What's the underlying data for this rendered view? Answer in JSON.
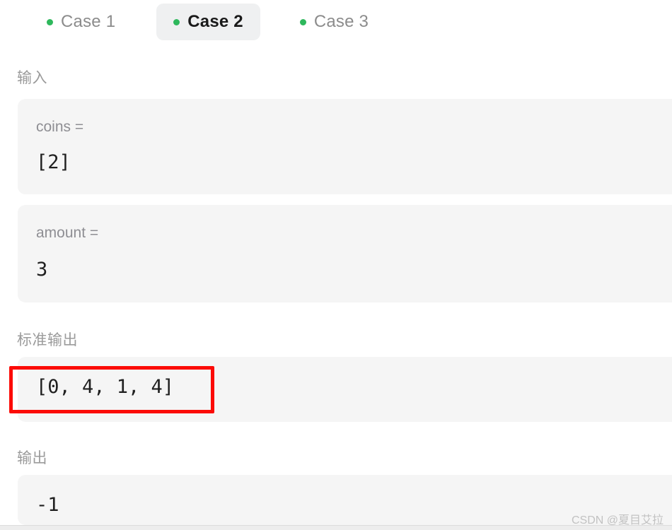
{
  "tabs": [
    {
      "label": "Case 1",
      "active": false,
      "dot_color": "#2eb85c"
    },
    {
      "label": "Case 2",
      "active": true,
      "dot_color": "#2eb85c"
    },
    {
      "label": "Case 3",
      "active": false,
      "dot_color": "#2eb85c"
    }
  ],
  "sections": {
    "input_label": "输入",
    "stdout_label": "标准输出",
    "output_label": "输出"
  },
  "input_fields": [
    {
      "key": "coins =",
      "value": "[2]"
    },
    {
      "key": "amount =",
      "value": "3"
    }
  ],
  "stdout": {
    "value": "[0, 4, 1, 4]"
  },
  "output": {
    "value": "-1"
  },
  "annotation": {
    "highlight_color": "#fc0b06",
    "target": "stdout"
  },
  "watermark": {
    "text": "CSDN @夏目艾拉"
  },
  "colors": {
    "panel_background": "#f5f5f5",
    "active_tab_background": "#eff0f1",
    "label_gray": "#9b9b9b",
    "value_dark": "#1f1f1f",
    "accent_green": "#2eb85c"
  }
}
